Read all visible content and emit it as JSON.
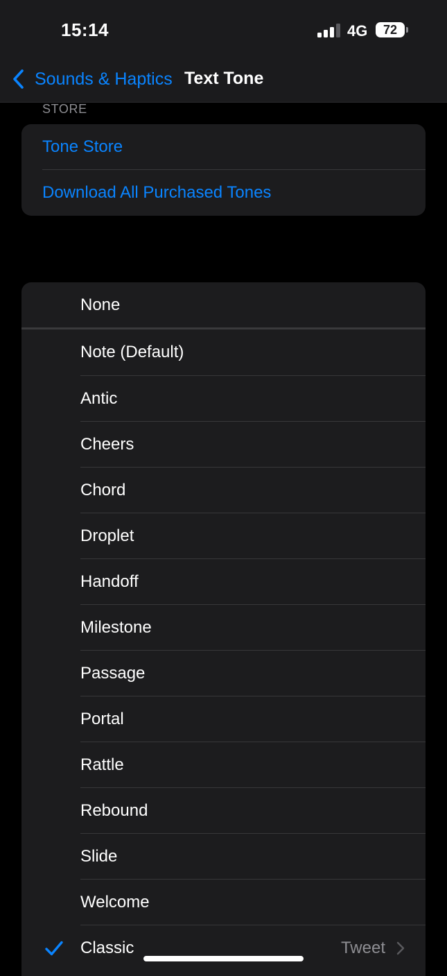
{
  "status_bar": {
    "time": "15:14",
    "network": "4G",
    "battery": "72"
  },
  "nav": {
    "back_label": "Sounds & Haptics",
    "title": "Text Tone"
  },
  "store_section": {
    "header": "STORE",
    "items": [
      {
        "label": "Tone Store"
      },
      {
        "label": "Download All Purchased Tones"
      }
    ]
  },
  "tones": {
    "none_label": "None",
    "items": [
      {
        "label": "Note (Default)"
      },
      {
        "label": "Antic"
      },
      {
        "label": "Cheers"
      },
      {
        "label": "Chord"
      },
      {
        "label": "Droplet"
      },
      {
        "label": "Handoff"
      },
      {
        "label": "Milestone"
      },
      {
        "label": "Passage"
      },
      {
        "label": "Portal"
      },
      {
        "label": "Rattle"
      },
      {
        "label": "Rebound"
      },
      {
        "label": "Slide"
      },
      {
        "label": "Welcome"
      },
      {
        "label": "Classic",
        "selected": true,
        "detail": "Tweet"
      }
    ]
  },
  "colors": {
    "accent": "#0a84ff",
    "background": "#000000",
    "cell": "#1c1c1e",
    "secondary_text": "#8e8e93"
  }
}
